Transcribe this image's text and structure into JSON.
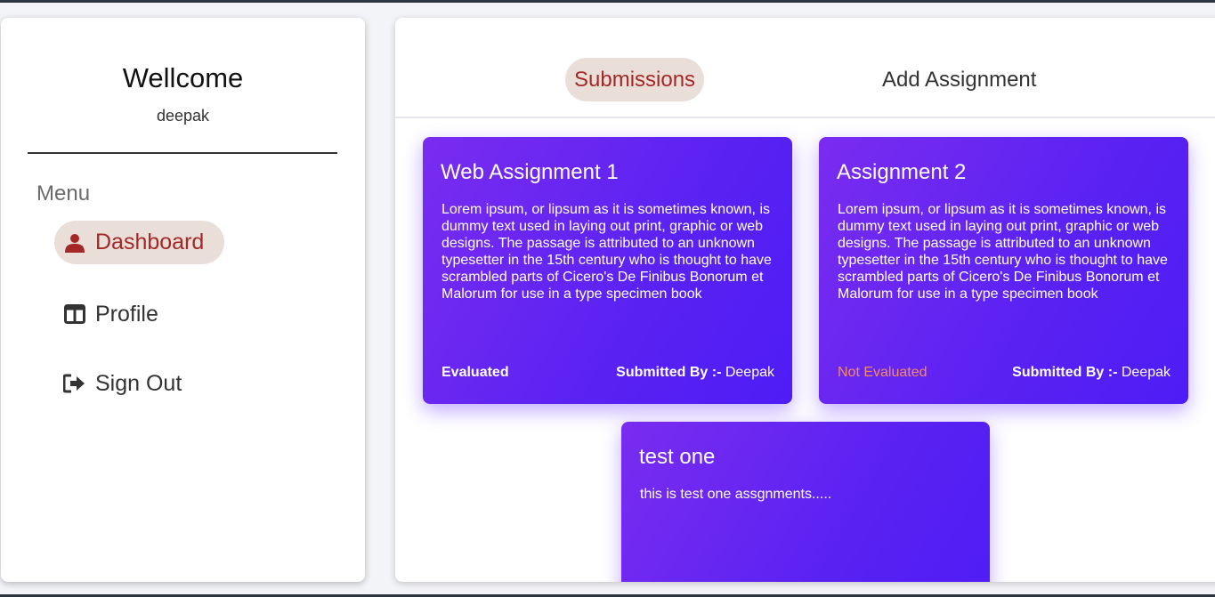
{
  "sidebar": {
    "welcome": "Wellcome",
    "username": "deepak",
    "menu_heading": "Menu",
    "items": [
      {
        "label": "Dashboard",
        "icon": "user-icon",
        "active": true
      },
      {
        "label": "Profile",
        "icon": "columns-icon",
        "active": false
      },
      {
        "label": "Sign Out",
        "icon": "sign-out-icon",
        "active": false
      }
    ]
  },
  "tabs": [
    {
      "label": "Submissions",
      "active": true
    },
    {
      "label": "Add Assignment",
      "active": false
    }
  ],
  "assignments": [
    {
      "title": "Web Assignment 1",
      "description": "Lorem ipsum, or lipsum as it is sometimes known, is dummy text used in laying out print, graphic or web designs. The passage is attributed to an unknown typesetter in the 15th century who is thought to have scrambled parts of Cicero's De Finibus Bonorum et Malorum for use in a type specimen book",
      "status": "Evaluated",
      "submitted_by_label": "Submitted By :-",
      "submitted_by": "Deepak"
    },
    {
      "title": "Assignment 2",
      "description": "Lorem ipsum, or lipsum as it is sometimes known, is dummy text used in laying out print, graphic or web designs. The passage is attributed to an unknown typesetter in the 15th century who is thought to have scrambled parts of Cicero's De Finibus Bonorum et Malorum for use in a type specimen book",
      "status": "Not Evaluated",
      "submitted_by_label": "Submitted By :-",
      "submitted_by": "Deepak"
    },
    {
      "title": "test one",
      "description": "this is test one assgnments....."
    }
  ],
  "colors": {
    "accent": "#a52828",
    "active_bg": "#eaded9",
    "card_gradient_start": "#7a2cf0",
    "card_gradient_end": "#4e1cf6",
    "not_evaluated": "#f58b63"
  }
}
